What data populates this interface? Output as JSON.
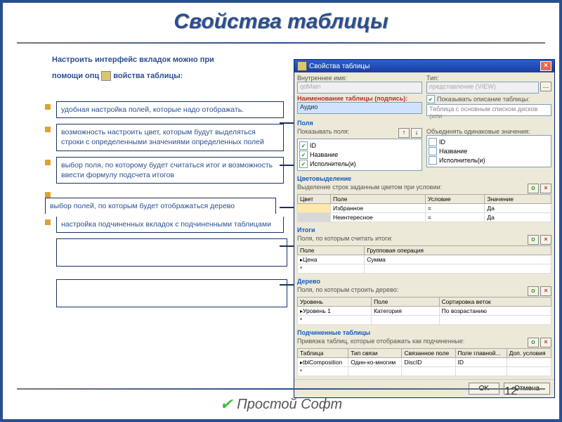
{
  "title": "Свойства таблицы",
  "intro": {
    "line1": "Настроить интерфейс вкладок можно при",
    "line2_a": "помощи опц",
    "line2_b": "войства таблицы:"
  },
  "bullets": [
    "удобная настройка полей, которые надо отображать.",
    "возможность настроить цвет, которым будут выделяться строки с определенными значениями определенных полей",
    "выбор поля, по которому будет считаться итог и возможность ввести формулу подсчета итогов",
    "выбор полей, по которым будет отображаться дерево",
    "настройка подчиненных вкладок с подчиненными таблицами"
  ],
  "dialog": {
    "title": "Свойства таблицы",
    "top": {
      "inner_name_lbl": "Внутреннее имя:",
      "inner_name_val": "qdMain",
      "type_lbl": "Тип:",
      "type_val": "представление (VIEW)",
      "caption_lbl": "Наименование таблицы (подпись):",
      "caption_val": "Аудио",
      "showdesc_lbl": "Показывать описание таблицы:",
      "desc_val": "Таблица с основным списком дисков (или"
    },
    "fields": {
      "hdr": "Поля",
      "show_lbl": "Показывать поля:",
      "merge_lbl": "Объединять одинаковые значения:",
      "left": [
        "ID",
        "Название",
        "Исполнитель(и)"
      ],
      "left_checked": [
        true,
        true,
        true
      ],
      "right": [
        "ID",
        "Название",
        "Исполнитель(и)"
      ],
      "right_checked": [
        false,
        false,
        false
      ]
    },
    "colors": {
      "hdr": "Цветовыделение",
      "sub": "Выделение строк заданным цветом при условии:",
      "cols": [
        "Цвет",
        "Поле",
        "Условие",
        "Значение"
      ],
      "rows": [
        [
          "",
          "Избранное",
          "=",
          "Да"
        ],
        [
          "",
          "Неинтересное",
          "=",
          "Да"
        ]
      ]
    },
    "totals": {
      "hdr": "Итоги",
      "sub": "Поля, по которым считать итоги:",
      "cols": [
        "Поле",
        "Групповая операция"
      ],
      "rows": [
        [
          "Цена",
          "Сумма"
        ]
      ]
    },
    "tree": {
      "hdr": "Дерево",
      "sub": "Поля, по которым строить дерево:",
      "cols": [
        "Уровень",
        "Поле",
        "Сортировка веток"
      ],
      "rows": [
        [
          "Уровень 1",
          "Категория",
          "По возрастанию"
        ]
      ]
    },
    "sub": {
      "hdr": "Подчиненные таблицы",
      "sub": "Привязка таблиц, которые отображать как подчиненные:",
      "cols": [
        "Таблица",
        "Тип связи",
        "Связанное поле",
        "Поле главной...",
        "Доп. условия"
      ],
      "rows": [
        [
          "tblComposition",
          "Один-ко-многим",
          "DiscID",
          "ID",
          ""
        ]
      ]
    },
    "ok": "OK",
    "cancel": "Отмена"
  },
  "brand": "Простой Софт",
  "page": "12"
}
